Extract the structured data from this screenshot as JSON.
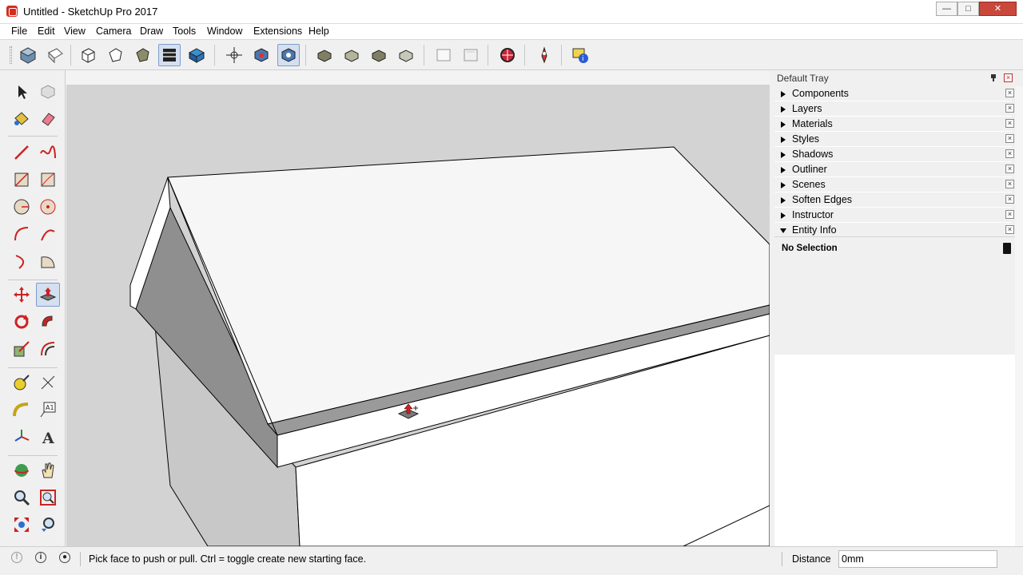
{
  "window": {
    "title": "Untitled - SketchUp Pro 2017",
    "minimize": "—",
    "maximize": "□",
    "close": "✕"
  },
  "menu": [
    "File",
    "Edit",
    "View",
    "Camera",
    "Draw",
    "Tools",
    "Window",
    "Extensions",
    "Help"
  ],
  "toolbar": {
    "selected_tool": "select-by-view-standard",
    "icons": [
      "iso-view",
      "top-view",
      "xray-style",
      "wireframe-style",
      "hidden-line-style",
      "shaded-style",
      "shaded-textures-style",
      "monochrome-style",
      "orbit",
      "pan",
      "zoom-extents",
      "front-view",
      "right-view",
      "back-view",
      "left-view",
      "section-plane",
      "display-section",
      "geo-location",
      "extension-warehouse",
      "entity-info"
    ]
  },
  "left_tools": {
    "selected": "push-pull",
    "labels": {
      "text_tool": "A1",
      "three_d_text": "A"
    }
  },
  "tray": {
    "title": "Default Tray",
    "panels": [
      {
        "label": "Components",
        "open": false
      },
      {
        "label": "Layers",
        "open": false
      },
      {
        "label": "Materials",
        "open": false
      },
      {
        "label": "Styles",
        "open": false
      },
      {
        "label": "Shadows",
        "open": false
      },
      {
        "label": "Outliner",
        "open": false
      },
      {
        "label": "Scenes",
        "open": false
      },
      {
        "label": "Soften Edges",
        "open": false
      },
      {
        "label": "Instructor",
        "open": false
      },
      {
        "label": "Entity Info",
        "open": true
      }
    ],
    "entity_info": {
      "status": "No Selection"
    }
  },
  "statusbar": {
    "message": "Pick face to push or pull.  Ctrl = toggle create new starting face.",
    "measure_label": "Distance",
    "measure_value": "0mm"
  },
  "colors": {
    "selection_highlight": "#d4dff0",
    "accent_red": "#d62b1e",
    "viewport_bg": "#ffffff"
  }
}
